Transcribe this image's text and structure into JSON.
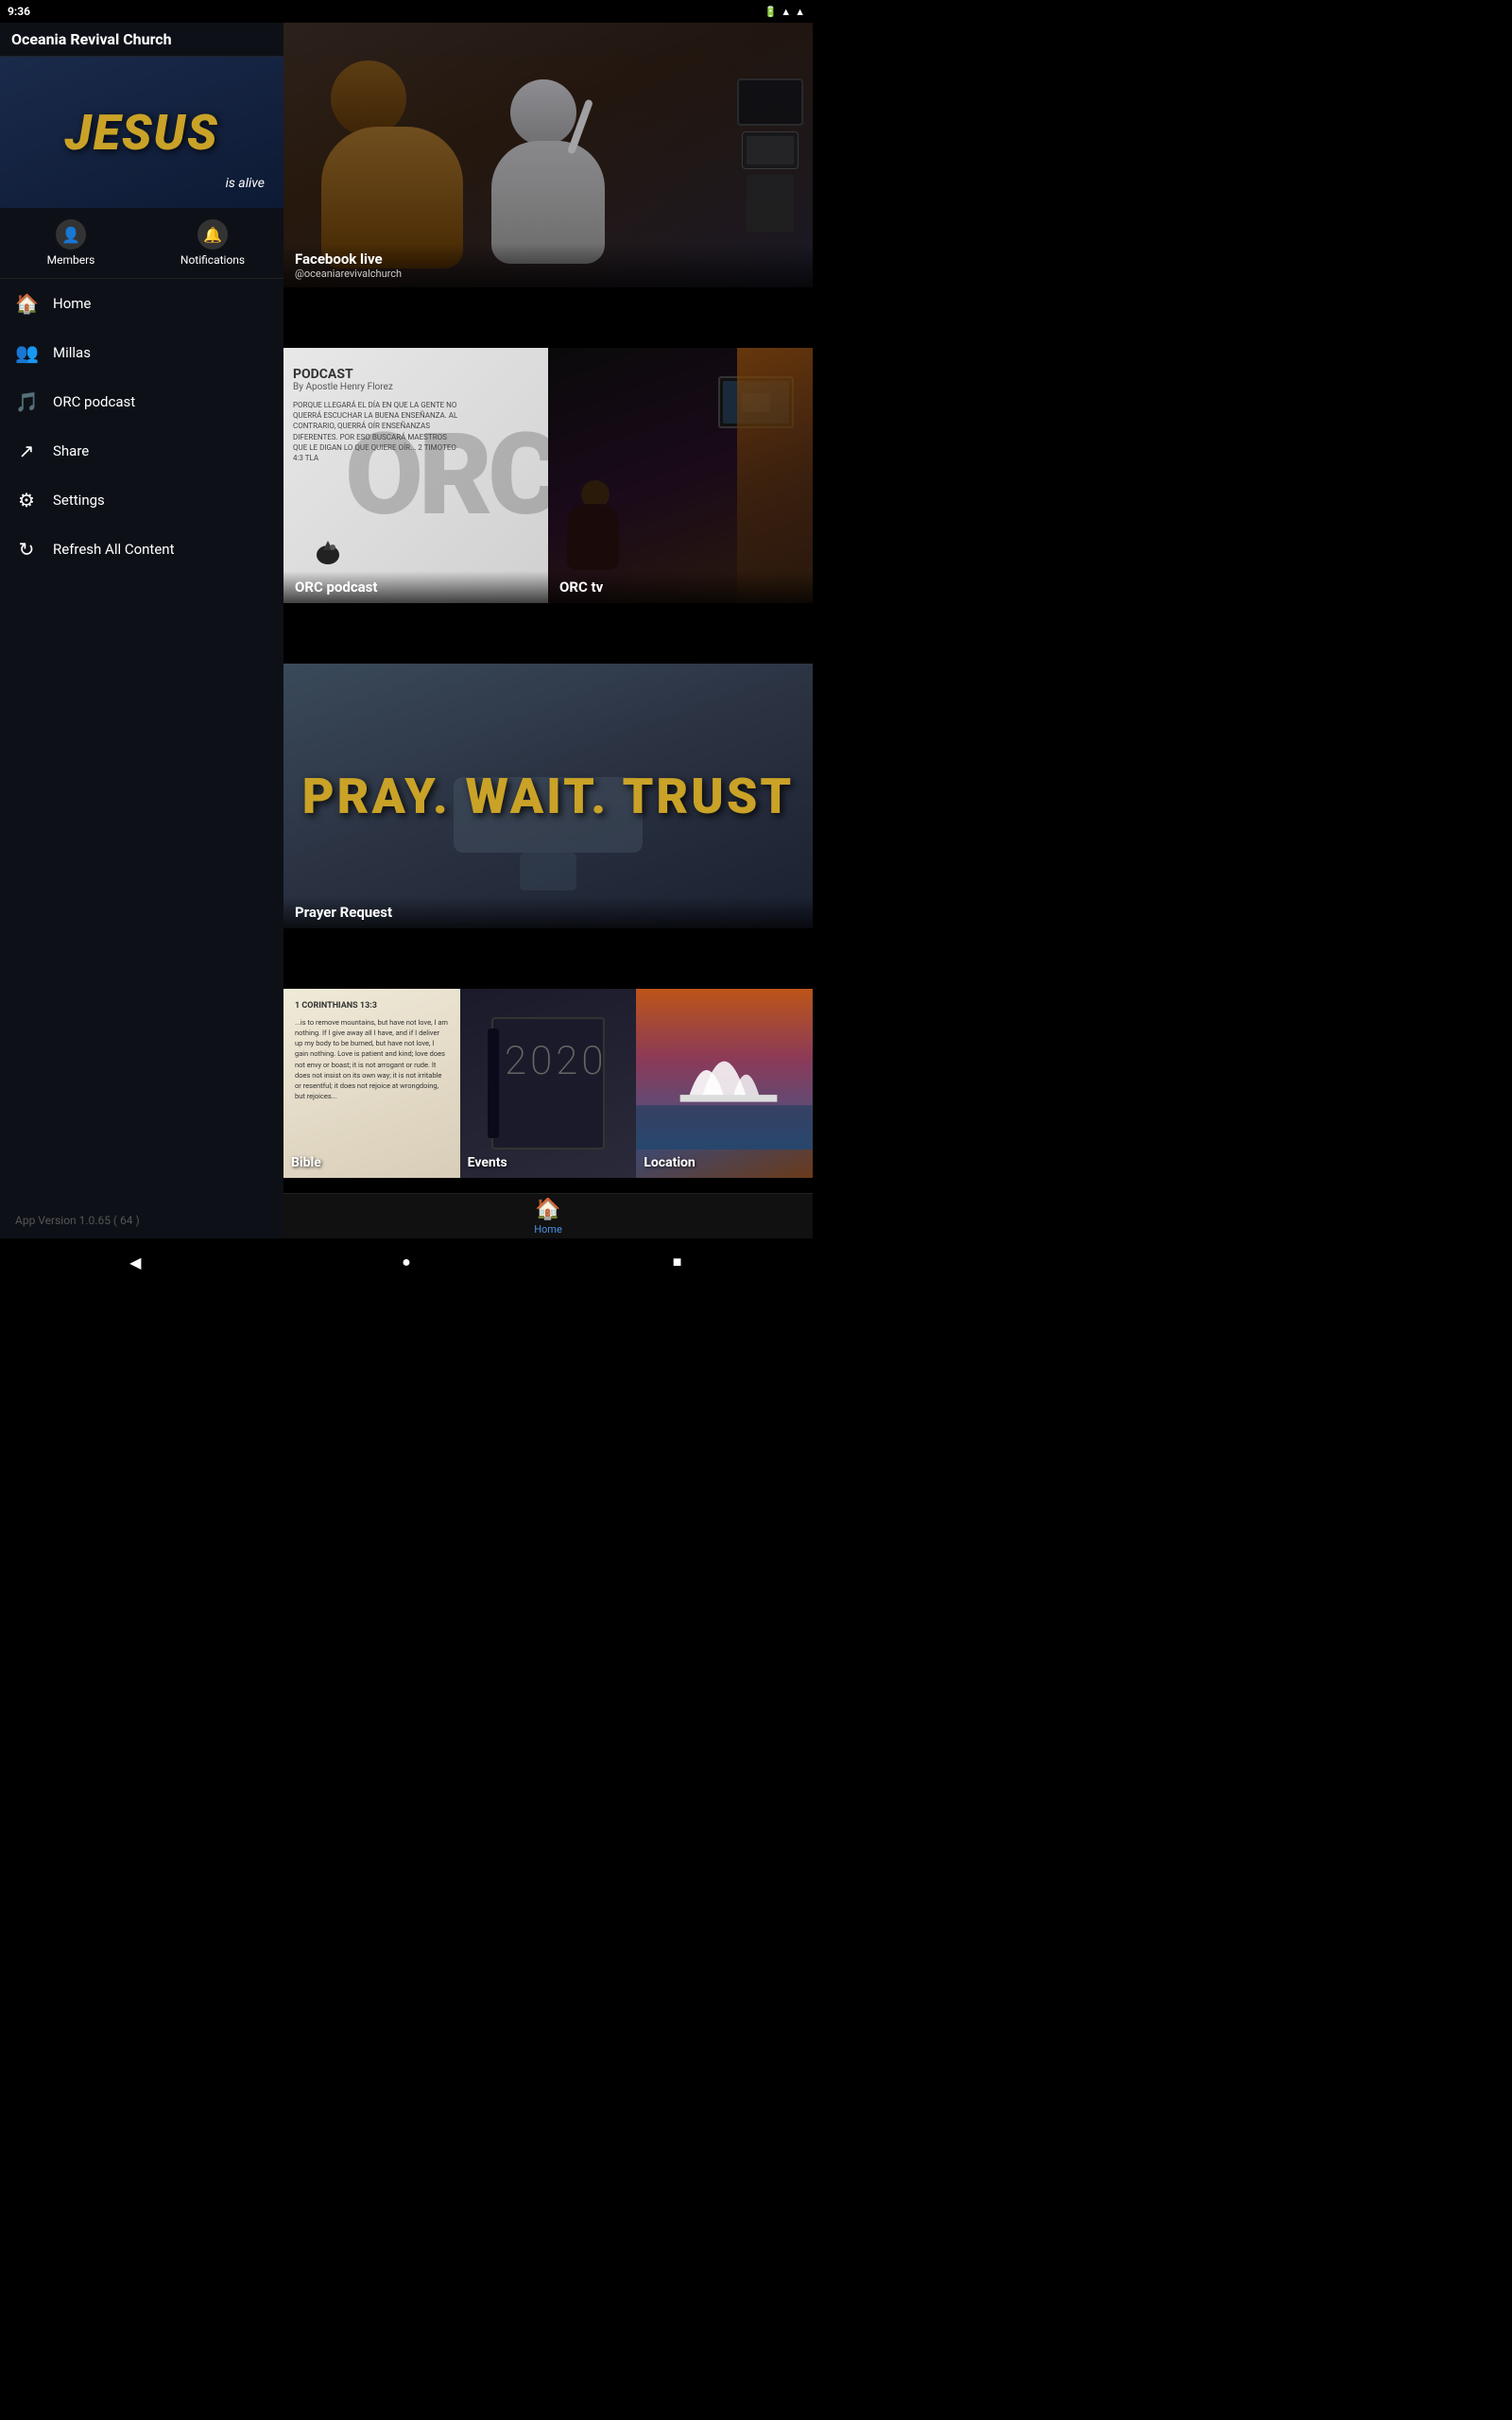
{
  "statusBar": {
    "time": "9:36",
    "icons": [
      "battery",
      "wifi",
      "signal"
    ]
  },
  "sidebar": {
    "appTitle": "Oceania Revival Church",
    "heroText": "JESUS",
    "heroSub": "is alive",
    "actions": [
      {
        "id": "members",
        "label": "Members",
        "icon": "👤"
      },
      {
        "id": "notifications",
        "label": "Notifications",
        "icon": "🔔"
      }
    ],
    "menuItems": [
      {
        "id": "home",
        "label": "Home",
        "icon": "🏠"
      },
      {
        "id": "millas",
        "label": "Millas",
        "icon": "👥"
      },
      {
        "id": "orc-podcast",
        "label": "ORC podcast",
        "icon": "🎵"
      },
      {
        "id": "share",
        "label": "Share",
        "icon": "↗"
      },
      {
        "id": "settings",
        "label": "Settings",
        "icon": "⚙"
      },
      {
        "id": "refresh",
        "label": "Refresh All Content",
        "icon": "↻"
      }
    ],
    "version": "App Version 1.0.65 ( 64 )"
  },
  "mainContent": {
    "cards": [
      {
        "id": "facebook-live",
        "title": "Facebook live",
        "subtitle": "@oceaniarevivalchurch"
      },
      {
        "id": "orc-podcast",
        "title": "ORC podcast",
        "subtitle": ""
      },
      {
        "id": "orc-tv",
        "title": "ORC tv",
        "subtitle": ""
      },
      {
        "id": "prayer-request",
        "title": "Prayer Request",
        "subtitle": "",
        "heroText": "PRAY. WAIT. TRUST"
      },
      {
        "id": "bible",
        "title": "Bible",
        "subtitle": ""
      },
      {
        "id": "events",
        "title": "Events",
        "subtitle": "",
        "year": "2020"
      },
      {
        "id": "location",
        "title": "Location",
        "subtitle": ""
      }
    ]
  },
  "bottomNav": {
    "homeLabel": "Home",
    "homeIcon": "🏠"
  },
  "podcastContent": {
    "title": "PODCAST",
    "by": "By Apostle Henry Florez",
    "verse": "PORQUE LLEGARÁ EL DÍA EN QUE LA GENTE NO QUERRÁ ESCUCHAR LA BUENA ENSEÑANZA. AL CONTRARIO, QUERRÁ OÍR ENSEÑANZAS DIFERENTES. POR ESO BUSCARÁ MAESTROS QUE LE DIGAN LO QUE QUIERE OÍR...\n2 TIMOTEO 4:3 TLA",
    "bigText": "ORC"
  },
  "bibleContent": {
    "reference": "1 CORINTHIANS 13:3",
    "text": "...is to remove mountains, but have not love, I am nothing. If I give away all I have, and if I deliver up my body to be burned, but have not love, I gain nothing. Love is patient and kind; love does not envy or boast; it is not arrogant or rude. It does not insist on its own way; it is not irritable or resentful; it does not rejoice at wrongdoing, but rejoices..."
  }
}
